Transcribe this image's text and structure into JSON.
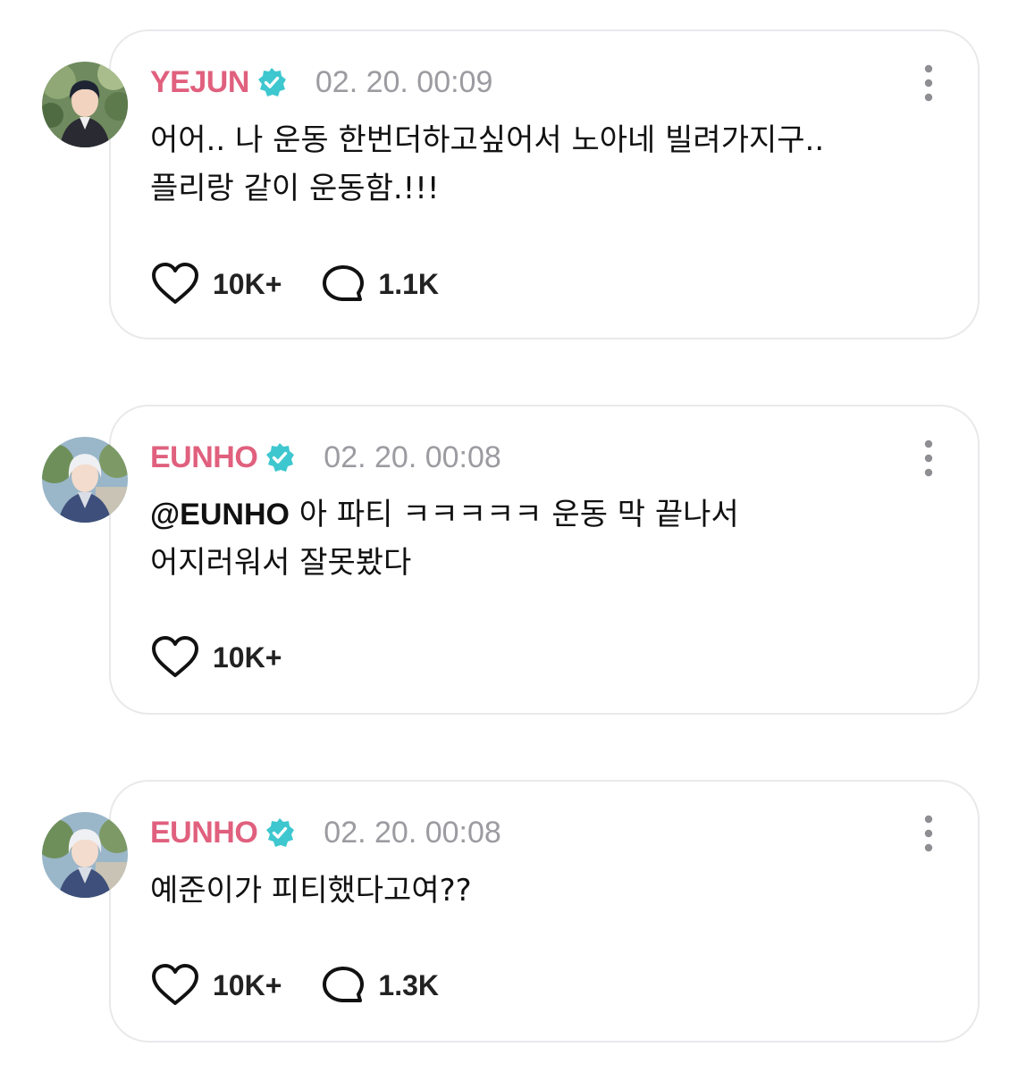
{
  "theme": {
    "username_color": "#e0607e",
    "badge_color": "#3ec7cf",
    "timestamp_color": "#9b9ba1",
    "card_border": "#e9e9ec"
  },
  "posts": [
    {
      "username": "YEJUN",
      "verified": true,
      "verified_icon": "verified-badge-icon",
      "timestamp": "02. 20. 00:09",
      "more_icon": "more-vertical-icon",
      "text_lines": [
        "어어.. 나 운동 한번더하고싶어서 노아네 빌려가지구..",
        "플리랑 같이 운동함.!!!"
      ],
      "likes": "10K+",
      "like_icon": "heart-icon",
      "comments": "1.1K",
      "comment_icon": "speech-bubble-icon"
    },
    {
      "username": "EUNHO",
      "verified": true,
      "verified_icon": "verified-badge-icon",
      "timestamp": "02. 20. 00:08",
      "more_icon": "more-vertical-icon",
      "mention": "@EUNHO",
      "text_lines": [
        " 아 파티 ㅋㅋㅋㅋㅋ 운동 막 끝나서",
        "어지러워서 잘못봤다"
      ],
      "likes": "10K+",
      "like_icon": "heart-icon"
    },
    {
      "username": "EUNHO",
      "verified": true,
      "verified_icon": "verified-badge-icon",
      "timestamp": "02. 20. 00:08",
      "more_icon": "more-vertical-icon",
      "text_lines": [
        "예준이가 피티했다고여??"
      ],
      "likes": "10K+",
      "like_icon": "heart-icon",
      "comments": "1.3K",
      "comment_icon": "speech-bubble-icon"
    }
  ]
}
